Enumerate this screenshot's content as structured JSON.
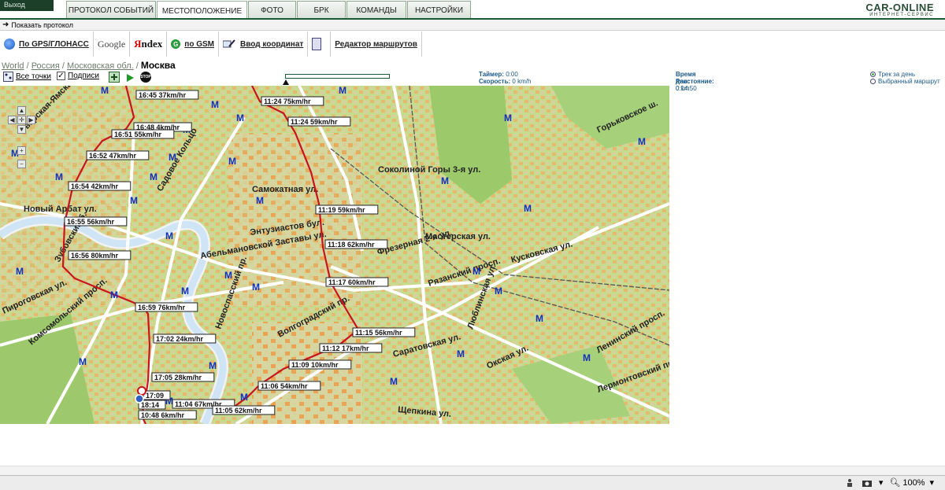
{
  "topbar": {
    "exit_label": "Выход",
    "tabs": [
      {
        "label": "ПРОТОКОЛ СОБЫТИЙ",
        "active": false
      },
      {
        "label": "МЕСТОПОЛОЖЕНИЕ",
        "active": true
      },
      {
        "label": "ФОТО",
        "active": false
      },
      {
        "label": "БРК",
        "active": false
      },
      {
        "label": "КОМАНДЫ",
        "active": false
      },
      {
        "label": "НАСТРОЙКИ",
        "active": false
      }
    ],
    "logo_brand": "CAR-ONLINE",
    "logo_tag": "ИНТЕРНЕТ-СЕРВИС"
  },
  "protocol": {
    "show_label": "Показать протокол"
  },
  "loc_toolbar": {
    "gps_label": "По GPS/ГЛОНАСС",
    "google_label": "Google",
    "yandex_y": "Я",
    "yandex_rest": "ndex",
    "gsm_label": "по GSM",
    "coords_label": "Ввод координат",
    "routes_label": "Редактор маршрутов"
  },
  "breadcrumb": {
    "items": [
      "World",
      "Россия",
      "Московская обл."
    ],
    "current": "Москва"
  },
  "controls": {
    "all_points_label": "Все точки",
    "captions_label": "Подписи",
    "captions_checked": true,
    "stop_label": "STOP",
    "timer_label": "Таймер:",
    "timer_value": "0:00",
    "speed_label": "Скорость:",
    "speed_value": "0 km/h",
    "day_time_label": "Время дня:",
    "day_time_value": "0:14:50",
    "distance_label": "Расстояние:",
    "distance_value": "0 km",
    "track_day_label": "Трек за день",
    "selected_route_label": "Выбранный маршрут",
    "track_day_selected": true
  },
  "map": {
    "track_color": "#c8141e",
    "route_a": [
      {
        "t": "16:45",
        "s": "37km/hr"
      },
      {
        "t": "16:48",
        "s": "4km/hr"
      },
      {
        "t": "16:51",
        "s": "55km/hr"
      },
      {
        "t": "16:52",
        "s": "47km/hr"
      },
      {
        "t": "16:54",
        "s": "42km/hr"
      },
      {
        "t": "16:55",
        "s": "56km/hr"
      },
      {
        "t": "16:56",
        "s": "80km/hr"
      },
      {
        "t": "16:59",
        "s": "76km/hr"
      },
      {
        "t": "17:02",
        "s": "24km/hr"
      },
      {
        "t": "17:05",
        "s": "28km/hr"
      },
      {
        "t": "17:09",
        "s": ""
      },
      {
        "t": "18:14",
        "s": ""
      },
      {
        "t": "10:48",
        "s": "6km/hr"
      }
    ],
    "route_b": [
      {
        "t": "11:24",
        "s": "75km/hr"
      },
      {
        "t": "11:24",
        "s": "59km/hr"
      },
      {
        "t": "11:19",
        "s": "59km/hr"
      },
      {
        "t": "11:18",
        "s": "62km/hr"
      },
      {
        "t": "11:17",
        "s": "60km/hr"
      },
      {
        "t": "11:15",
        "s": "56km/hr"
      },
      {
        "t": "11:12",
        "s": "17km/hr"
      },
      {
        "t": "11:09",
        "s": "10km/hr"
      },
      {
        "t": "11:06",
        "s": "54km/hr"
      },
      {
        "t": "11:04",
        "s": "67km/hr"
      },
      {
        "t": "11:05",
        "s": "62km/hr"
      }
    ],
    "streets": [
      "Новый Арбат ул.",
      "Энтузиастов бул.",
      "Рязанский просп.",
      "Волгоградский пр.",
      "Комсомольский просп.",
      "Ленинский просп.",
      "Абельмановской Заставы ул.",
      "Новоспасский пр.",
      "Самокатная ул.",
      "Соколиной Горы 3-я ул.",
      "Мастерская ул.",
      "Кусковская ул.",
      "Лермонтовский просп.",
      "Саратовская ул.",
      "Окская ул.",
      "Люблинская ул.",
      "Щепкина ул.",
      "Пироговская ул.",
      "Зубовский б.",
      "Садовое Кольцо",
      "Горьковское ш.",
      "Тверская-Ямская ул.",
      "Фрезерная 2-я ул."
    ]
  },
  "statusbar": {
    "zoom": "100%"
  }
}
